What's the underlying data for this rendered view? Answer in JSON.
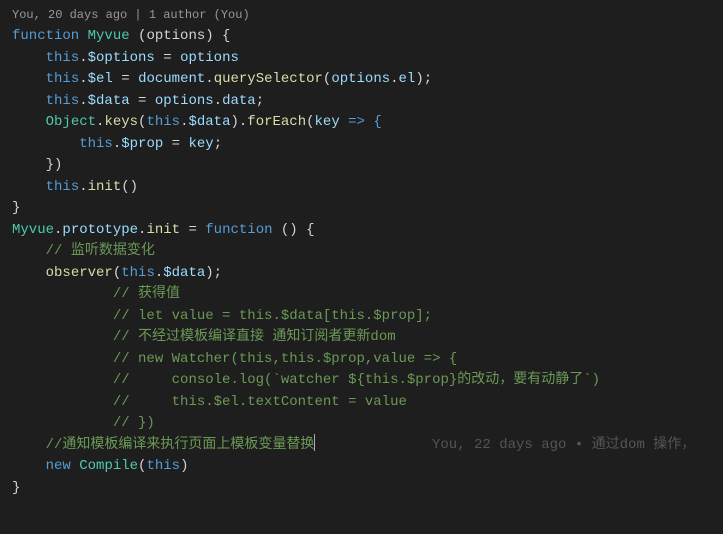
{
  "codelens": "You, 20 days ago | 1 author (You)",
  "code": {
    "l1": {
      "kw": "function",
      "cls": "Myvue",
      "sig": " (options) {"
    },
    "l2": {
      "indent": "    ",
      "this": "this",
      "dot": ".",
      "prop": "$options",
      "eq": " = ",
      "rhs": "options"
    },
    "l3": {
      "indent": "    ",
      "this": "this",
      "dot": ".",
      "prop": "$el",
      "eq": " = ",
      "obj": "document",
      "dot2": ".",
      "method": "querySelector",
      "open": "(",
      "arg1": "options",
      "dot3": ".",
      "arg2": "el",
      "close": ");"
    },
    "l4": {
      "indent": "    ",
      "this": "this",
      "dot": ".",
      "prop": "$data",
      "eq": " = ",
      "rhs1": "options",
      "dot2": ".",
      "rhs2": "data",
      "end": ";"
    },
    "l5": {
      "indent": "    ",
      "obj": "Object",
      "dot": ".",
      "method1": "keys",
      "open1": "(",
      "this": "this",
      "dot2": ".",
      "prop": "$data",
      "close1": ").",
      "method2": "forEach",
      "open2": "(",
      "param": "key",
      "arrow": " => {"
    },
    "l6": {
      "indent": "        ",
      "this": "this",
      "dot": ".",
      "prop": "$prop",
      "eq": " = ",
      "rhs": "key",
      "end": ";"
    },
    "l7": {
      "indent": "    ",
      "text": "})"
    },
    "l8": {
      "indent": "    ",
      "this": "this",
      "dot": ".",
      "method": "init",
      "call": "()"
    },
    "l9": {
      "text": "}"
    },
    "l10": {
      "cls": "Myvue",
      "dot": ".",
      "proto": "prototype",
      "dot2": ".",
      "prop": "init",
      "eq": " = ",
      "kw": "function",
      "sig": " () {"
    },
    "l11": {
      "indent": "    ",
      "comment": "// 监听数据变化"
    },
    "l12": {
      "indent": "    ",
      "fn": "observer",
      "open": "(",
      "this": "this",
      "dot": ".",
      "prop": "$data",
      "close": ");"
    },
    "l13": {
      "indent": "            ",
      "comment": "// 获得值"
    },
    "l14": {
      "indent": "            ",
      "comment": "// let value = this.$data[this.$prop];"
    },
    "l15": {
      "indent": "            ",
      "comment": "// 不经过模板编译直接 通知订阅者更新dom"
    },
    "l16": {
      "indent": "            ",
      "comment": "// new Watcher(this,this.$prop,value => {"
    },
    "l17": {
      "indent": "            ",
      "comment": "//     console.log(`watcher ${this.$prop}的改动，要有动静了`)"
    },
    "l18": {
      "indent": "            ",
      "comment": "//     this.$el.textContent = value"
    },
    "l19": {
      "indent": "            ",
      "comment": "// })"
    },
    "l20": {
      "indent": "    ",
      "comment": "//通知模板编译来执行页面上模板变量替换"
    },
    "l21": {
      "indent": "    ",
      "kw": "new",
      "sp": " ",
      "cls": "Compile",
      "open": "(",
      "this": "this",
      "close": ")"
    },
    "l22": {
      "text": "}"
    }
  },
  "inlineBlame": {
    "prefix": "You, 22 days ago",
    "bullet": " • ",
    "suffix": "通过dom 操作，"
  }
}
